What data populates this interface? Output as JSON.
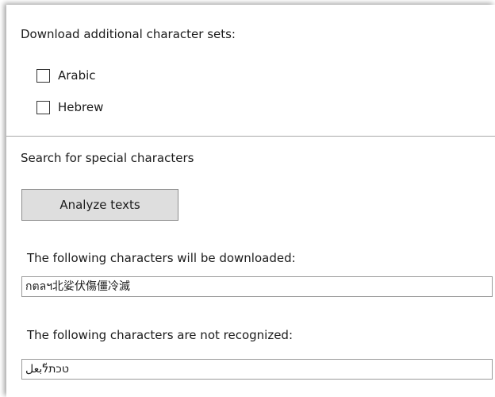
{
  "download_section": {
    "heading": "Download additional character sets:",
    "options": [
      {
        "label": "Arabic",
        "checked": false
      },
      {
        "label": "Hebrew",
        "checked": false
      }
    ]
  },
  "search_section": {
    "heading": "Search for special characters",
    "analyze_button_label": "Analyze texts",
    "download_label": "The following characters will be downloaded:",
    "download_value": "กตลฯ北娑伏傷僵冷滅",
    "unrecognized_label": "The following characters are not recognized:",
    "unrecognized_value": "טכתלّبعل"
  }
}
